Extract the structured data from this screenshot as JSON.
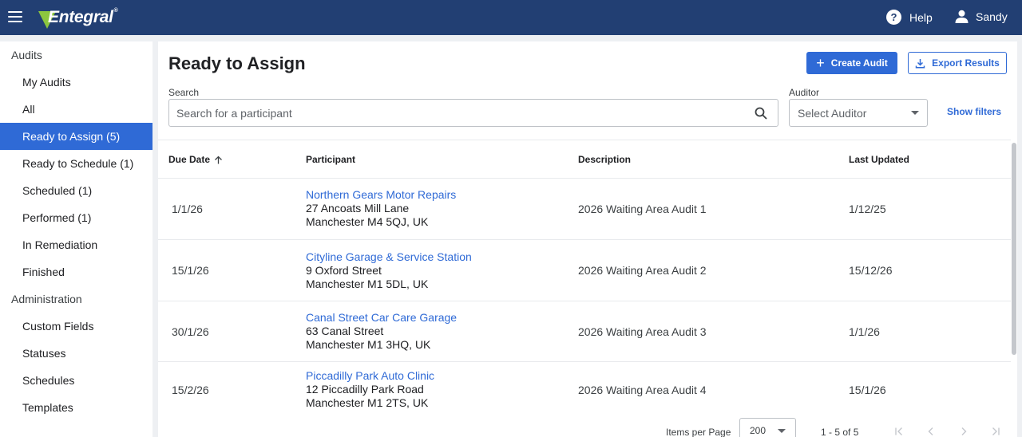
{
  "header": {
    "app_name": "Entegral",
    "logo_trademark": "®",
    "help_label": "Help",
    "user_name": "Sandy",
    "bar_color": "#223f73"
  },
  "sidebar": {
    "audits_section": "Audits",
    "audit_items": [
      {
        "label": "My Audits",
        "active": false
      },
      {
        "label": "All",
        "active": false
      },
      {
        "label": "Ready to Assign (5)",
        "active": true
      },
      {
        "label": "Ready to Schedule (1)",
        "active": false
      },
      {
        "label": "Scheduled (1)",
        "active": false
      },
      {
        "label": "Performed (1)",
        "active": false
      },
      {
        "label": "In Remediation",
        "active": false
      },
      {
        "label": "Finished",
        "active": false
      }
    ],
    "admin_section": "Administration",
    "admin_items": [
      {
        "label": "Custom Fields"
      },
      {
        "label": "Statuses"
      },
      {
        "label": "Schedules"
      },
      {
        "label": "Templates"
      }
    ],
    "active_color": "#2f6ad6"
  },
  "main": {
    "title": "Ready to Assign",
    "create_button": "Create Audit",
    "export_button": "Export Results",
    "search_label": "Search",
    "search_placeholder": "Search for a participant",
    "auditor_label": "Auditor",
    "auditor_placeholder": "Select Auditor",
    "show_filters": "Show filters"
  },
  "table": {
    "columns": [
      "Due Date",
      "Participant",
      "Description",
      "Last Updated"
    ],
    "sort_column": "Due Date",
    "sort_direction": "ascending",
    "rows": [
      {
        "due_date": "1/1/26",
        "participant_name": "Northern Gears Motor Repairs",
        "address_line1": "27 Ancoats Mill Lane",
        "address_line2": "Manchester M4 5QJ, UK",
        "description": "2026 Waiting Area Audit 1",
        "last_updated": "1/12/25"
      },
      {
        "due_date": "15/1/26",
        "participant_name": "Cityline Garage & Service Station",
        "address_line1": "9 Oxford Street",
        "address_line2": "Manchester M1 5DL, UK",
        "description": "2026 Waiting Area Audit 2",
        "last_updated": "15/12/26"
      },
      {
        "due_date": "30/1/26",
        "participant_name": "Canal Street Car Care Garage",
        "address_line1": "63 Canal Street",
        "address_line2": "Manchester M1 3HQ, UK",
        "description": "2026 Waiting Area Audit 3",
        "last_updated": "1/1/26"
      },
      {
        "due_date": "15/2/26",
        "participant_name": "Piccadilly Park Auto Clinic",
        "address_line1": "12 Piccadilly Park Road",
        "address_line2": "Manchester M1 2TS, UK",
        "description": "2026 Waiting Area Audit 4",
        "last_updated": "15/1/26"
      }
    ]
  },
  "paginator": {
    "items_per_page_label": "Items per Page",
    "items_per_page_value": "200",
    "range_label": "1 - 5 of 5"
  }
}
